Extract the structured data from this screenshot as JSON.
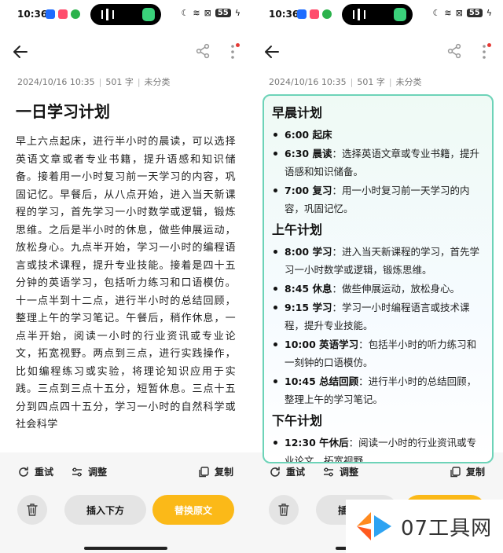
{
  "status_bar": {
    "time": "10:36",
    "battery": "55"
  },
  "meta": {
    "datetime": "2024/10/16 10:35",
    "word_count": "501 字",
    "category": "未分类"
  },
  "document": {
    "title": "一日学习计划",
    "body": "早上六点起床，进行半小时的晨读，可以选择英语文章或者专业书籍，提升语感和知识储备。接着用一小时复习前一天学习的内容，巩固记忆。早餐后，从八点开始，进入当天新课程的学习，首先学习一小时数学或逻辑，锻炼思维。之后是半小时的休息，做些伸展运动，放松身心。九点半开始，学习一小时的编程语言或技术课程，提升专业技能。接着是四十五分钟的英语学习，包括听力练习和口语模仿。十一点半到十二点，进行半小时的总结回顾，整理上午的学习笔记。午餐后，稍作休息，一点半开始，阅读一小时的行业资讯或专业论文，拓宽视野。两点到三点，进行实践操作，比如编程练习或实验，将理论知识应用于实践。三点到三点十五分，短暂休息。三点十五分到四点四十五分，学习一小时的自然科学或社会科学"
  },
  "plan": {
    "sections": [
      {
        "heading": "早晨计划",
        "items": [
          {
            "time": "6:00 起床",
            "text": ""
          },
          {
            "time": "6:30 晨读",
            "text": "：选择英语文章或专业书籍，提升语感和知识储备。"
          },
          {
            "time": "7:00 复习",
            "text": "：用一小时复习前一天学习的内容，巩固记忆。"
          }
        ]
      },
      {
        "heading": "上午计划",
        "items": [
          {
            "time": "8:00 学习",
            "text": "：进入当天新课程的学习，首先学习一小时数学或逻辑，锻炼思维。"
          },
          {
            "time": "8:45 休息",
            "text": "：做些伸展运动，放松身心。"
          },
          {
            "time": "9:15 学习",
            "text": "：学习一小时编程语言或技术课程，提升专业技能。"
          },
          {
            "time": "10:00 英语学习",
            "text": "：包括半小时的听力练习和一刻钟的口语模仿。"
          },
          {
            "time": "10:45 总结回顾",
            "text": "：进行半小时的总结回顾，整理上午的学习笔记。"
          }
        ]
      },
      {
        "heading": "下午计划",
        "items": [
          {
            "time": "12:30 午休后",
            "text": "：阅读一小时的行业资讯或专业论文，拓宽视野。"
          }
        ]
      }
    ]
  },
  "toolbar": {
    "retry": "重试",
    "adjust": "调整",
    "copy": "复制",
    "insert_below": "插入下方",
    "replace": "替换原文"
  },
  "watermark": {
    "text": "07工具网"
  },
  "colors": {
    "accent": "#fbb918",
    "card_border": "#6dd3b8",
    "notification_dot": "#e53935"
  }
}
